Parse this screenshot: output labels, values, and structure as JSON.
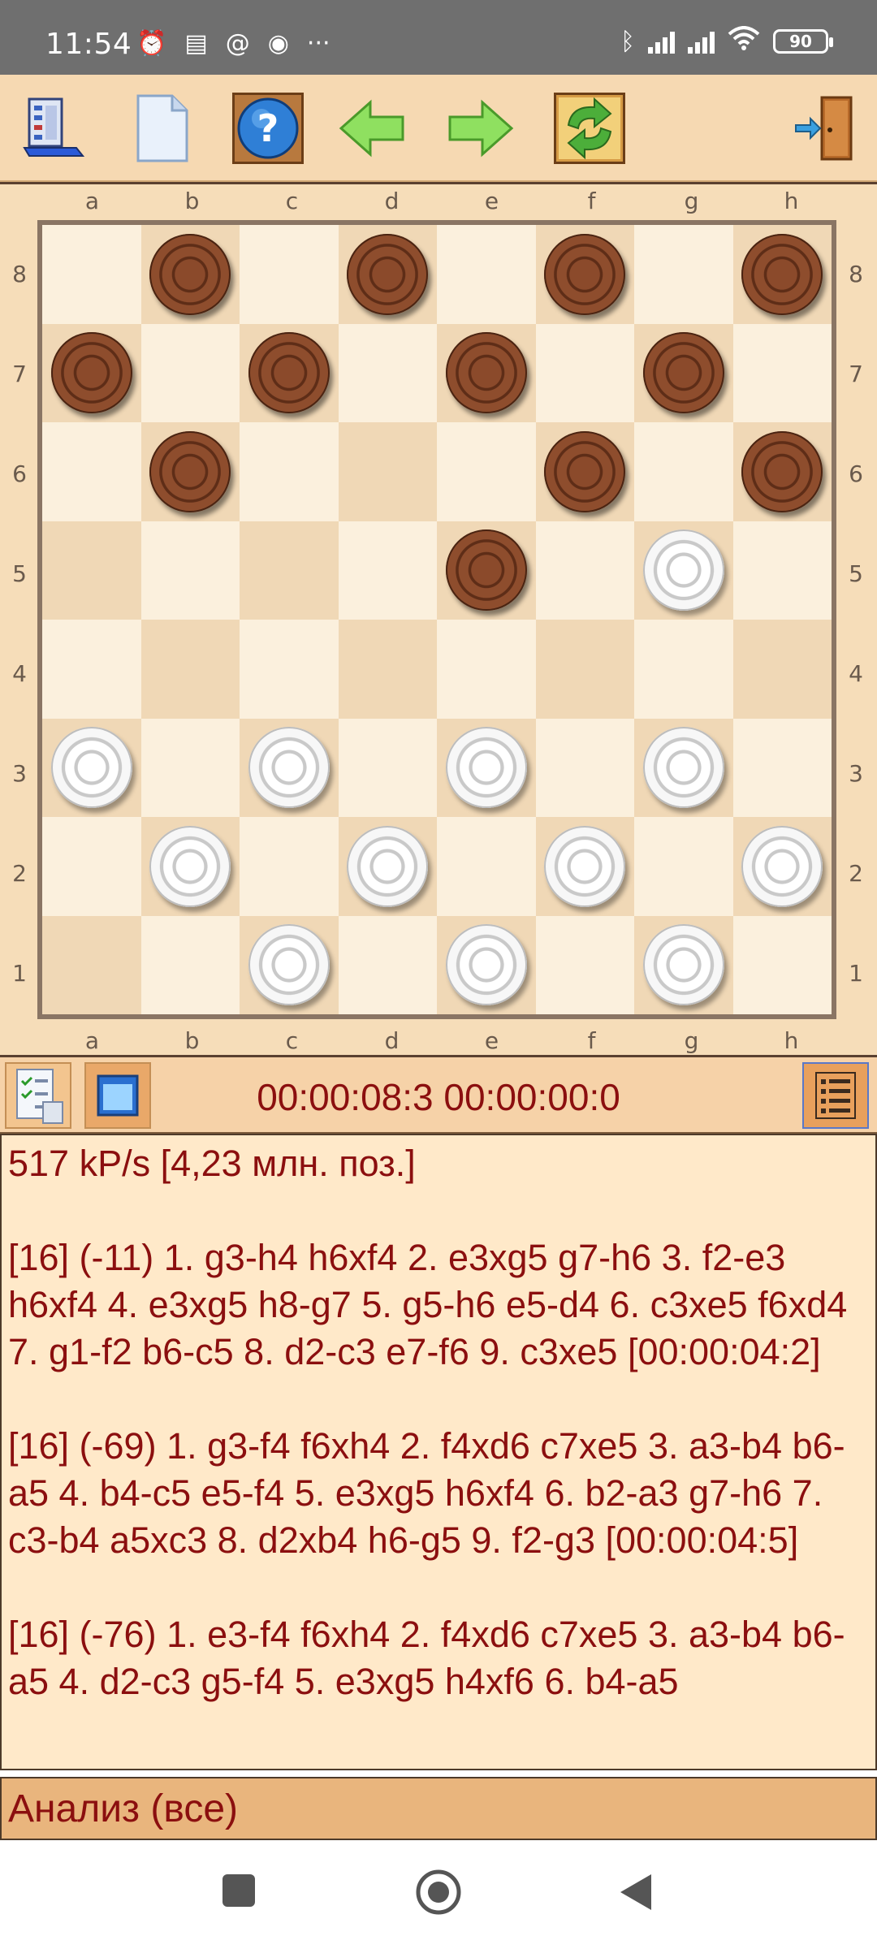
{
  "status_bar": {
    "time": "11:54",
    "battery": "90",
    "more": "···"
  },
  "toolbar": {
    "buttons": [
      "menu-icon",
      "new-game-icon",
      "help-icon",
      "back-arrow-icon",
      "forward-arrow-icon",
      "flip-board-icon",
      "exit-door-icon"
    ]
  },
  "board": {
    "files": [
      "a",
      "b",
      "c",
      "d",
      "e",
      "f",
      "g",
      "h"
    ],
    "ranks": [
      "8",
      "7",
      "6",
      "5",
      "4",
      "3",
      "2",
      "1"
    ],
    "pieces": {
      "b8": "black",
      "d8": "black",
      "f8": "black",
      "h8": "black",
      "a7": "black",
      "c7": "black",
      "e7": "black",
      "g7": "black",
      "b6": "black",
      "f6": "black",
      "h6": "black",
      "e5": "black",
      "g5": "white",
      "a3": "white",
      "c3": "white",
      "e3": "white",
      "g3": "white",
      "b2": "white",
      "d2": "white",
      "f2": "white",
      "h2": "white",
      "c1": "white",
      "e1": "white",
      "g1": "white"
    }
  },
  "info": {
    "timer": "00:00:08:3 00:00:00:0"
  },
  "analysis": {
    "lines": [
      "517 kP/s [4,23 млн. поз.]",
      "[16] (-11)  1. g3-h4 h6xf4 2. e3xg5 g7-h6 3. f2-e3 h6xf4 4. e3xg5 h8-g7 5. g5-h6 e5-d4 6. c3xe5 f6xd4 7. g1-f2 b6-c5 8. d2-c3 e7-f6 9. c3xe5 [00:00:04:2]",
      "[16] (-69)  1. g3-f4 f6xh4 2. f4xd6 c7xe5 3. a3-b4 b6-a5 4. b4-c5 e5-f4 5. e3xg5 h6xf4 6. b2-a3 g7-h6 7. c3-b4 a5xc3 8. d2xb4 h6-g5 9. f2-g3 [00:00:04:5]",
      "[16] (-76)  1. e3-f4 f6xh4 2. f4xd6 c7xe5 3. a3-b4 b6-a5 4. d2-c3 g5-f4 5. e3xg5 h4xf6 6. b4-a5"
    ]
  },
  "footer": {
    "label": "Анализ (все)"
  }
}
